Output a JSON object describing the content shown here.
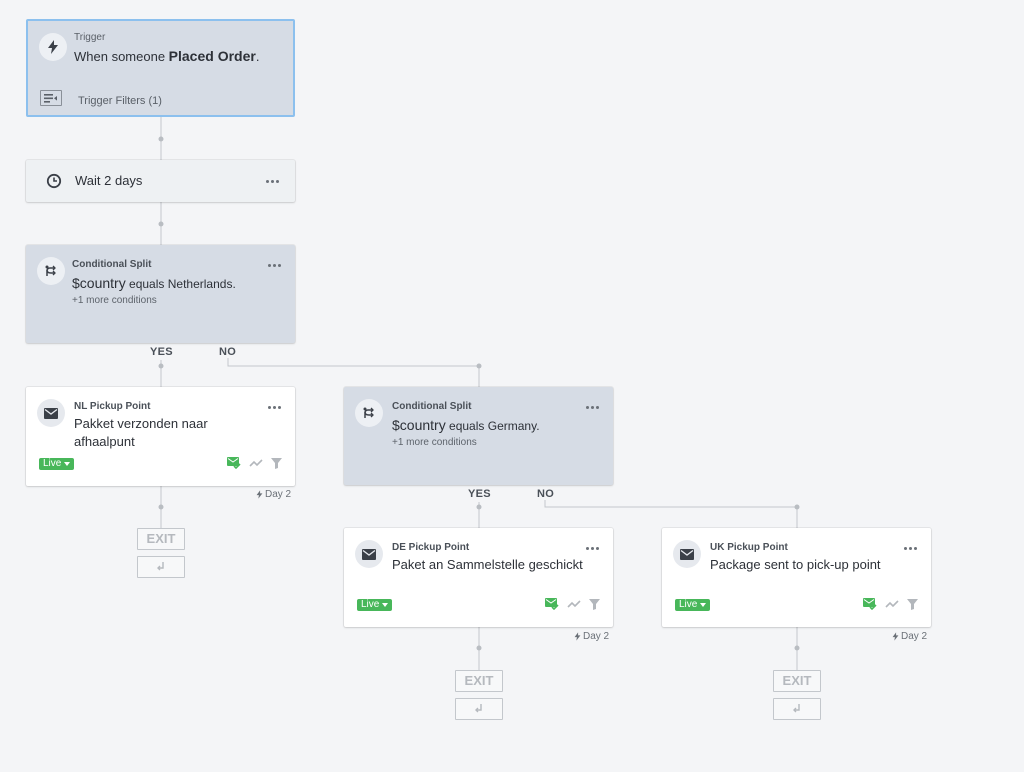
{
  "trigger": {
    "eyebrow": "Trigger",
    "prefix": "When someone ",
    "event": "Placed Order",
    "suffix": ".",
    "filters_label": "Trigger Filters (1)"
  },
  "wait": {
    "label": "Wait 2 days"
  },
  "split1": {
    "eyebrow": "Conditional Split",
    "variable": "$country",
    "condition": " equals Netherlands.",
    "more": "+1 more conditions",
    "yes": "YES",
    "no": "NO"
  },
  "split2": {
    "eyebrow": "Conditional Split",
    "variable": "$country",
    "condition": " equals Germany.",
    "more": "+1 more conditions",
    "yes": "YES",
    "no": "NO"
  },
  "email_nl": {
    "eyebrow": "NL Pickup Point",
    "title": "Pakket verzonden naar afhaalpunt",
    "status": "Live",
    "day": "Day 2"
  },
  "email_de": {
    "eyebrow": "DE Pickup Point",
    "title": "Paket an Sammelstelle geschickt",
    "status": "Live",
    "day": "Day 2"
  },
  "email_uk": {
    "eyebrow": "UK Pickup Point",
    "title": "Package sent to pick-up point",
    "status": "Live",
    "day": "Day 2"
  },
  "exit_label": "EXIT",
  "colors": {
    "live_green": "#48b75a",
    "trigger_border": "#8cc0ee",
    "card_gray": "#d6dce5"
  },
  "icons": [
    "bolt-icon",
    "filter-list-icon",
    "clock-icon",
    "split-icon",
    "envelope-icon",
    "more-icon",
    "email-check-icon",
    "trend-icon",
    "funnel-icon",
    "return-arrow-icon"
  ]
}
